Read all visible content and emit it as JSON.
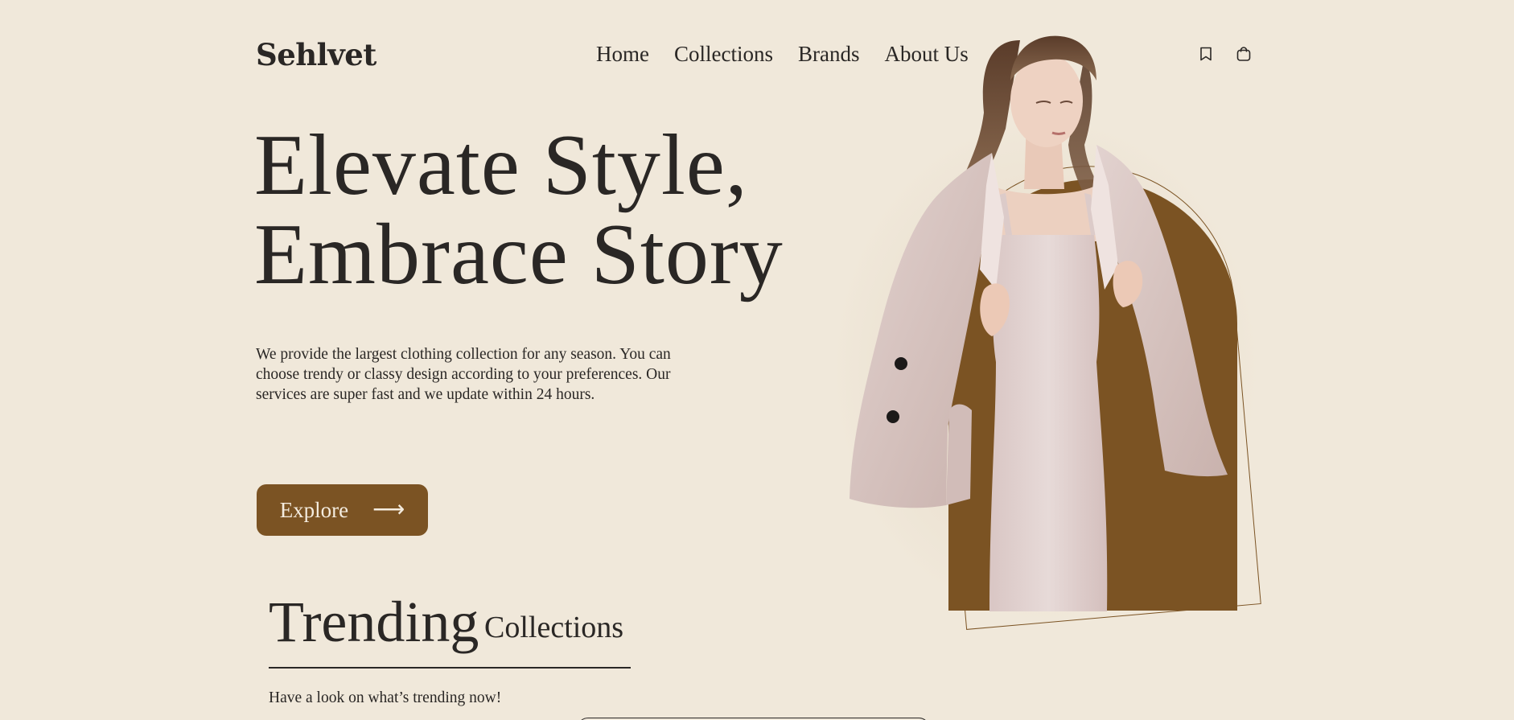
{
  "header": {
    "logo": "Sehlvet",
    "nav": [
      {
        "label": "Home"
      },
      {
        "label": "Collections"
      },
      {
        "label": "Brands"
      },
      {
        "label": "About Us"
      }
    ],
    "icons": [
      "bookmark-icon",
      "shopping-bag-icon"
    ]
  },
  "hero": {
    "title_line1": "Elevate Style,",
    "title_line2": "Embrace Story",
    "description": "We provide the largest clothing collection for any season. You can choose trendy or classy design according to your preferences. Our services are super fast and we update within 24 hours.",
    "cta_label": "Explore",
    "cta_icon": "arrow-right-icon"
  },
  "trending": {
    "title": "Trending",
    "subtitle": "Collections",
    "description": "Have a look on what’s trending now!"
  },
  "colors": {
    "background": "#f0e8da",
    "accent": "#7b5323",
    "text": "#2a2725",
    "button_text": "#f4ecdf"
  }
}
